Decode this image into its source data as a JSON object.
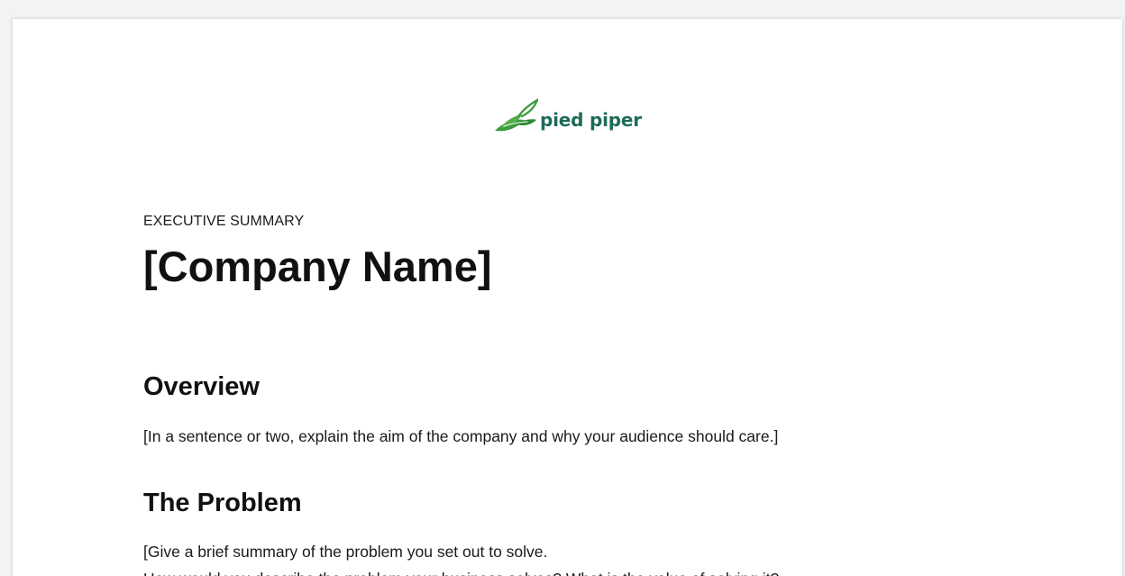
{
  "logo": {
    "text": "pied piper",
    "icon": "leaf-hat-icon",
    "color": "#1d6b58"
  },
  "document": {
    "eyebrow": "EXECUTIVE SUMMARY",
    "title": "[Company Name]",
    "sections": [
      {
        "heading": "Overview",
        "body": "[In a sentence or two, explain the aim of the company and why your audience should care.]"
      },
      {
        "heading": "The Problem",
        "body_lines": [
          "[Give a brief summary of the problem you set out to solve.",
          "How would you describe the problem your business solves? What is the value of solving it?"
        ]
      }
    ]
  }
}
